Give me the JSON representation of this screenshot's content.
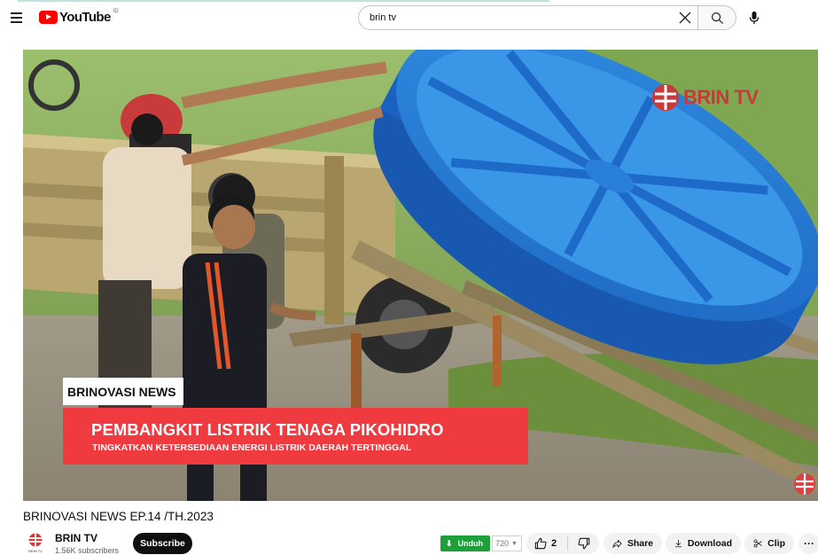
{
  "masthead": {
    "logo_text": "YouTube",
    "region_code": "ID",
    "search_value": "brin tv",
    "icons": [
      "menu-icon",
      "youtube-logo-icon",
      "clear-icon",
      "search-icon",
      "mic-icon"
    ]
  },
  "player": {
    "watermark": "BRIN TV",
    "tag_label": "BRINOVASI NEWS",
    "headline": "PEMBANGKIT LISTRIK TENAGA PIKOHIDRO",
    "subheadline": "TINGKATKAN KETERSEDIAAN ENERGI LISTRIK DAERAH TERTINGGAL",
    "colors": {
      "brand_red": "#ef3b40",
      "turbine_blue": "#1f6fd1"
    }
  },
  "video": {
    "title": "BRINOVASI NEWS EP.14 /TH.2023"
  },
  "channel": {
    "name": "BRIN TV",
    "avatar_label": "BRIN TV",
    "subscribers": "1.56K subscribers",
    "subscribe_label": "Subscribe"
  },
  "actions": {
    "unduh_label": "Unduh",
    "quality": "720",
    "like_count": "2",
    "share_label": "Share",
    "download_label": "Download",
    "clip_label": "Clip",
    "more_label": "···"
  }
}
